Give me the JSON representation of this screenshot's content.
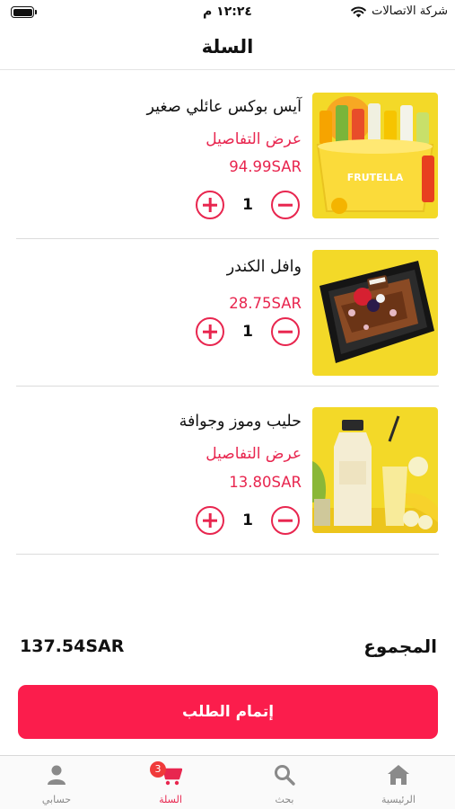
{
  "status_bar": {
    "time": "١٢:٢٤ م",
    "carrier": "شركة الاتصالات"
  },
  "header": {
    "title": "السلة"
  },
  "cart": {
    "items": [
      {
        "name": "آيس بوكس عائلي صغير",
        "details_link": "عرض التفاصيل",
        "price": "94.99SAR",
        "quantity": "1",
        "image_icon": "ice-box-product-image",
        "image_text": "FRUTELLA"
      },
      {
        "name": "وافل الكندر",
        "price": "28.75SAR",
        "quantity": "1",
        "image_icon": "waffle-product-image"
      },
      {
        "name": "حليب وموز وجوافة",
        "details_link": "عرض التفاصيل",
        "price": "13.80SAR",
        "quantity": "1",
        "image_icon": "milk-bottle-product-image"
      }
    ]
  },
  "summary": {
    "total_label": "المجموع",
    "total_value": "137.54SAR"
  },
  "checkout": {
    "label": "إتمام الطلب"
  },
  "tab_bar": {
    "tabs": [
      {
        "label": "الرئيسية",
        "icon": "home-icon"
      },
      {
        "label": "بحث",
        "icon": "search-icon"
      },
      {
        "label": "السلة",
        "icon": "cart-icon",
        "badge": "3",
        "active": true
      },
      {
        "label": "حسابي",
        "icon": "user-icon"
      }
    ]
  },
  "colors": {
    "accent": "#e8264f",
    "checkout_button": "#fb1d4c",
    "image_background": "#f3d928"
  }
}
